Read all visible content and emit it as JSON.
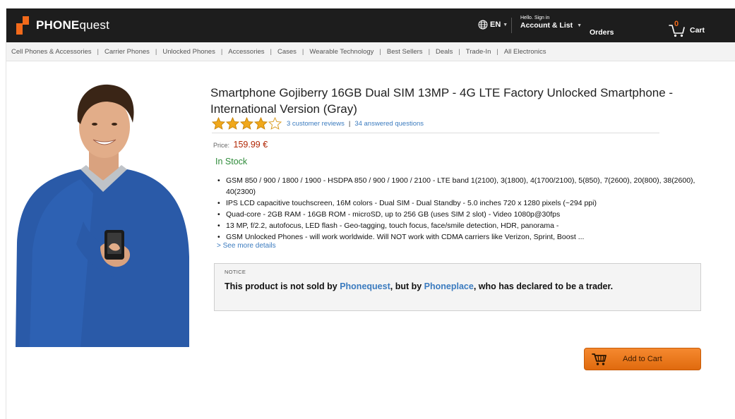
{
  "brand": {
    "name_bold": "PHONE",
    "name_light": "quest",
    "accent": "#f26a1b"
  },
  "header": {
    "language": "EN",
    "account_greeting": "Hello. Sign in",
    "account_label": "Account & List",
    "orders_label": "Orders",
    "cart_label": "Cart",
    "cart_count": "0"
  },
  "subnav": {
    "items": [
      "Cell Phones & Accessories",
      "Carrier Phones",
      "Unlocked Phones",
      "Accessories",
      "Cases",
      "Wearable Technology",
      "Best Sellers",
      "Deals",
      "Trade-In",
      "All Electronics"
    ]
  },
  "product": {
    "title": "Smartphone Gojiberry 16GB Dual SIM 13MP - 4G LTE Factory Unlocked Smartphone - International Version (Gray)",
    "rating": 4,
    "rating_max": 5,
    "reviews_link": "3 customer reviews",
    "questions_link": "34 answered questions",
    "price_label": "Price:",
    "price": "159.99 €",
    "stock": "In Stock",
    "bullets": [
      "GSM 850 / 900 / 1800 / 1900 - HSDPA 850 / 900 / 1900 / 2100 - LTE band 1(2100), 3(1800), 4(1700/2100), 5(850), 7(2600), 20(800), 38(2600), 40(2300)",
      "IPS LCD capacitive touchscreen, 16M colors - Dual SIM - Dual Standby - 5.0 inches 720 x 1280 pixels (~294 ppi)",
      "Quad-core - 2GB RAM - 16GB ROM - microSD, up to 256 GB (uses SIM 2 slot) - Video 1080p@30fps",
      "13 MP, f/2.2, autofocus, LED flash - Geo-tagging, touch focus, face/smile detection, HDR, panorama -",
      "GSM Unlocked Phones - will work worldwide. Will NOT work with CDMA carriers like Verizon, Sprint, Boost ..."
    ],
    "more_link": "> See more details"
  },
  "notice": {
    "label": "NOTICE",
    "msg_1": "This product is not sold by ",
    "seller_1": "Phonequest",
    "msg_2": ", but by ",
    "seller_2": "Phoneplace",
    "msg_3": ", who has declared to be a trader."
  },
  "actions": {
    "add_to_cart": "Add to Cart"
  },
  "colors": {
    "link": "#3b7bbf",
    "price": "#b12704",
    "stock": "#2e8b3a",
    "button": "#f5892f"
  }
}
